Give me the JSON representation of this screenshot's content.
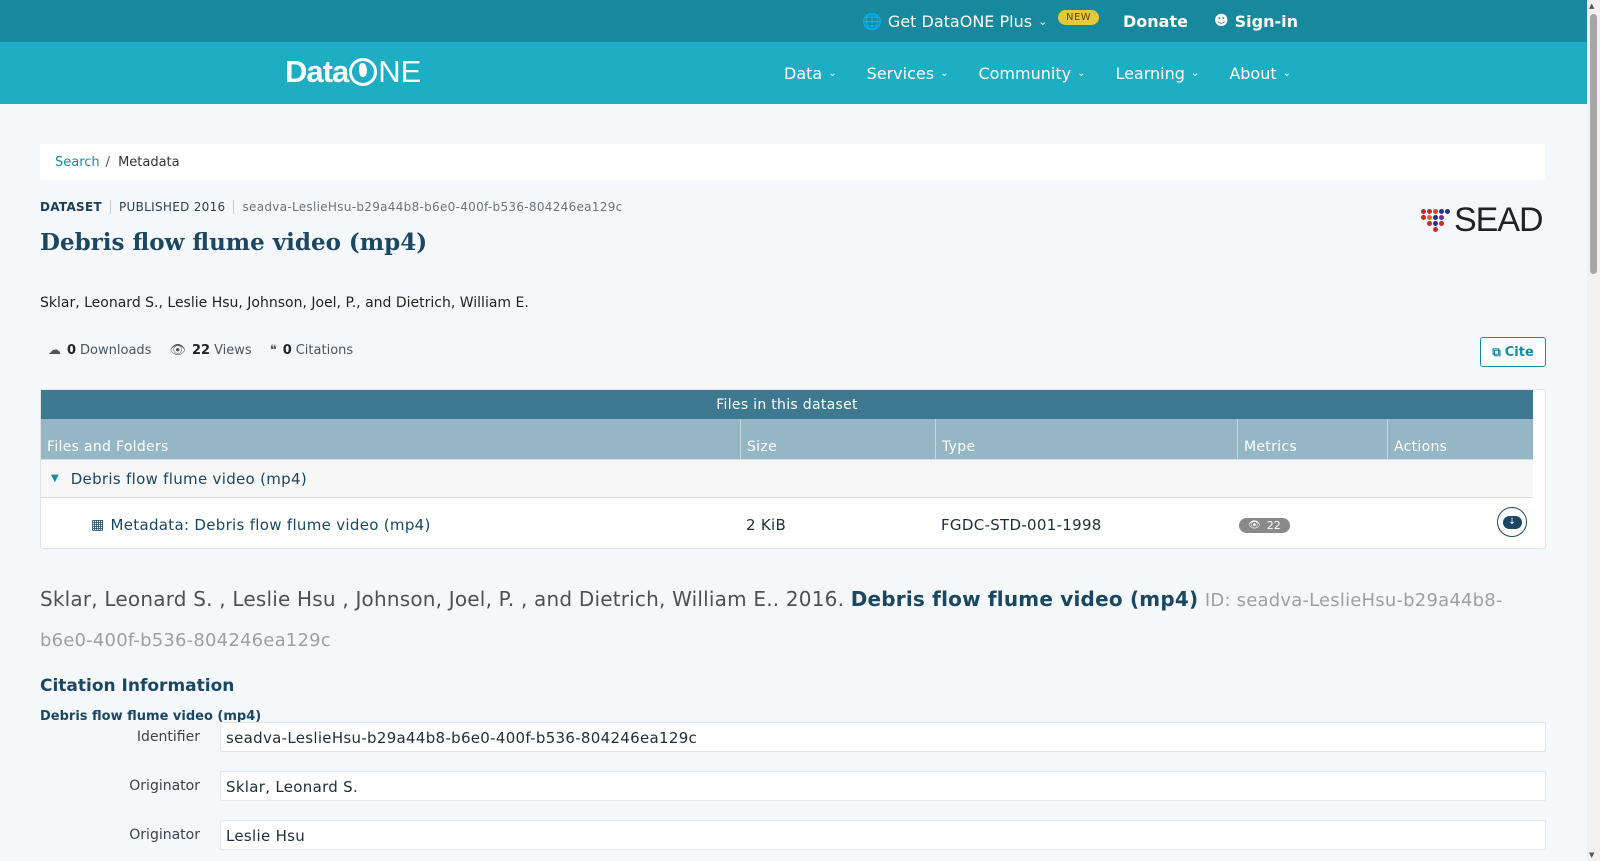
{
  "topbar": {
    "plus_label": "Get DataONE Plus",
    "new_badge": "NEW",
    "donate": "Donate",
    "signin": "Sign-in"
  },
  "navbar": {
    "logo_data": "Data",
    "logo_one": "NE",
    "links": [
      "Data",
      "Services",
      "Community",
      "Learning",
      "About"
    ]
  },
  "breadcrumb": {
    "search": "Search",
    "separator": "/",
    "current": "Metadata"
  },
  "dataset": {
    "kind": "DATASET",
    "published": "PUBLISHED 2016",
    "id": "seadva-LeslieHsu-b29a44b8-b6e0-400f-b536-804246ea129c",
    "title": "Debris flow flume video (mp4)",
    "authors": "Sklar, Leonard S., Leslie Hsu, Johnson, Joel, P., and Dietrich, William E.",
    "repo_logo_text": "SEAD"
  },
  "stats": {
    "downloads_count": "0",
    "downloads_label": "Downloads",
    "views_count": "22",
    "views_label": "Views",
    "citations_count": "0",
    "citations_label": "Citations"
  },
  "cite_button": "Cite",
  "files": {
    "caption": "Files in this dataset",
    "headers": [
      "Files and Folders",
      "Size",
      "Type",
      "Metrics",
      "Actions"
    ],
    "folder": "Debris flow flume video (mp4)",
    "rows": [
      {
        "name": "Metadata: Debris flow flume video (mp4)",
        "size": "2 KiB",
        "type": "FGDC-STD-001-1998",
        "views": "22"
      }
    ]
  },
  "citation": {
    "authors": "Sklar, Leonard S. , Leslie Hsu , Johnson, Joel, P. , and Dietrich, William E.. 2016.",
    "title": "Debris flow flume video (mp4)",
    "id": "ID: seadva-LeslieHsu-b29a44b8-b6e0-400f-b536-804246ea129c"
  },
  "citation_info": {
    "heading": "Citation Information",
    "subheading": "Debris flow flume video (mp4)",
    "fields": [
      {
        "label": "Identifier",
        "value": "seadva-LeslieHsu-b29a44b8-b6e0-400f-b536-804246ea129c"
      },
      {
        "label": "Originator",
        "value": "Sklar, Leonard S."
      },
      {
        "label": "Originator",
        "value": "Leslie Hsu"
      }
    ]
  },
  "colors": {
    "topbar": "#16899e",
    "navbar": "#1daec4",
    "table_caption": "#3f7891",
    "table_header": "#94b6c5",
    "title": "#1b4763"
  }
}
